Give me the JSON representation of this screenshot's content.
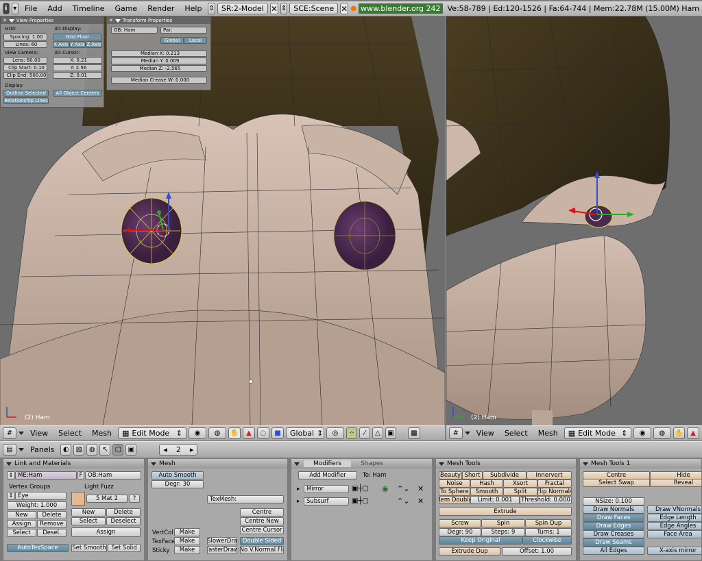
{
  "top_bar": {
    "menus": [
      "File",
      "Add",
      "Timeline",
      "Game",
      "Render",
      "Help"
    ],
    "screen_field": "SR:2-Model",
    "scene_field": "SCE:Scene",
    "url": "www.blender.org 242",
    "stats": "Ve:58-789 | Ed:120-1526 | Fa:64-744 | Mem:22.78M (15.00M) Ham"
  },
  "viewport_left": {
    "label": "(2) Ham",
    "view_props": {
      "title": "View Properties",
      "grid_label": "Grid:",
      "spacing": "Spacing: 1.00",
      "lines": "Lines: 60",
      "display_3d": "3D Display:",
      "grid_floor": "Grid Floor",
      "x_axis": "X Axis",
      "y_axis": "Y Axis",
      "z_axis": "Z Axis",
      "view_camera": "View Camera:",
      "lens": "Lens: 60.00",
      "clip_start": "Clip Start: 0.10",
      "clip_end": "Clip End: 500.00",
      "cursor_3d": "3D Cursor:",
      "cx": "X: 0.21",
      "cy": "Y: 2.56",
      "cz": "Z: 0.01",
      "display": "Display:",
      "outline_selected": "Outline Selected",
      "all_object_centers": "All Object Centers",
      "relationship_lines": "Relationship Lines"
    },
    "transform_props": {
      "title": "Transform Properties",
      "ob": "OB: Ham",
      "par": "Par:",
      "global": "Global",
      "local": "Local",
      "median_x": "Median X: 0.213",
      "median_y": "Median Y: 0.009",
      "median_z": "Median Z: -2.565",
      "median_crease": "Median Crease W: 0.000"
    }
  },
  "viewport_right": {
    "label": "(2) Ham"
  },
  "header_left": {
    "view": "View",
    "select": "Select",
    "mesh": "Mesh",
    "mode": "Edit Mode",
    "orientation": "Global"
  },
  "header_right": {
    "view": "View",
    "select": "Select",
    "mesh": "Mesh",
    "mode": "Edit Mode"
  },
  "buttons_header": {
    "panels": "Panels",
    "frame": "2"
  },
  "link_materials": {
    "title": "Link and Materials",
    "me": "ME:Ham",
    "f": "F",
    "ob": "OB:Ham",
    "vertex_groups": "Vertex Groups",
    "group": "Eye",
    "weight": "Weight: 1.000",
    "new": "New",
    "delete": "Delete",
    "assign": "Assign",
    "remove": "Remove",
    "select": "Select",
    "desel": "Desel.",
    "light_fuzz": "Light Fuzz",
    "mat": "5 Mat 2",
    "q": "?",
    "m_new": "New",
    "m_delete": "Delete",
    "m_select": "Select",
    "m_deselect": "Deselect",
    "m_assign": "Assign",
    "autotexspace": "AutoTexSpace",
    "set_smooth": "Set Smooth",
    "set_solid": "Set Solid"
  },
  "mesh_panel": {
    "title": "Mesh",
    "auto_smooth": "Auto Smooth",
    "degr": "Degr: 30",
    "texmesh": "TexMesh:",
    "centre": "Centre",
    "centre_new": "Centre New",
    "centre_cursor": "Centre Cursor",
    "vertcol": "VertCol",
    "texface": "TexFace",
    "sticky": "Sticky",
    "make": "Make",
    "slower_draw": "SlowerDra",
    "faster_draw": "FasterDraw",
    "double_sided": "Double Sided",
    "no_vnormal": "No V.Normal Fli"
  },
  "modifiers": {
    "tab_modifiers": "Modifiers",
    "tab_shapes": "Shapes",
    "add_modifier": "Add Modifier",
    "to": "To: Ham",
    "list": [
      "Mirror",
      "Subsurf"
    ]
  },
  "mesh_tools": {
    "title": "Mesh Tools",
    "beauty": "Beauty",
    "short": "Short",
    "subdivide": "Subdivide",
    "innervert": "Innervert",
    "noise": "Noise",
    "hash": "Hash",
    "xsort": "Xsort",
    "fractal": "Fractal",
    "to_sphere": "To Sphere",
    "smooth": "Smooth",
    "split": "Split",
    "flip_normals": "Flip Normals",
    "rem_double": "Rem Double",
    "limit": "Limit: 0.001",
    "threshold": "Threshold: 0.000",
    "extrude": "Extrude",
    "screw": "Screw",
    "spin": "Spin",
    "spin_dup": "Spin Dup",
    "degr": "Degr: 90",
    "steps": "Steps: 9",
    "turns": "Turns: 1",
    "keep_original": "Keep Original",
    "clockwise": "Clockwise",
    "extrude_dup": "Extrude Dup",
    "offset": "Offset: 1.00"
  },
  "mesh_tools1": {
    "title": "Mesh Tools 1",
    "centre": "Centre",
    "hide": "Hide",
    "select_swap": "Select Swap",
    "reveal": "Reveal",
    "nsize": "NSize: 0.100",
    "draw_normals": "Draw Normals",
    "draw_vnormals": "Draw VNormals",
    "draw_faces": "Draw Faces",
    "edge_length": "Edge Length",
    "draw_edges": "Draw Edges",
    "edge_angles": "Edge Angles",
    "draw_creases": "Draw Creases",
    "face_area": "Face Area",
    "draw_seams": "Draw Seams",
    "all_edges": "All Edges",
    "x_axis_mirror": "X-axis mirror"
  }
}
